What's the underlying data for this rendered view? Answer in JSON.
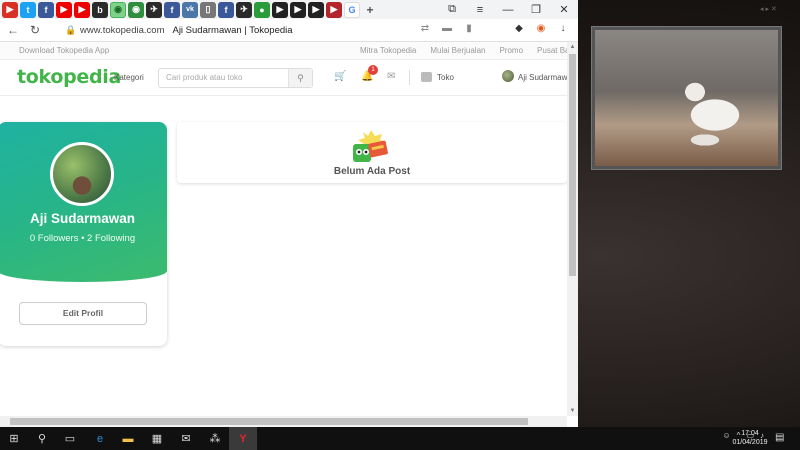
{
  "browser": {
    "tab_colors": [
      "#d93025",
      "#1da1f2",
      "#3b5998",
      "#e00",
      "#e00",
      "#2a2a2a",
      "#7fd18a",
      "#2f8f3e",
      "#2a2a2a",
      "#3b5998",
      "#4a76a8",
      "#777",
      "#3b5998",
      "#2a2a2a",
      "#2a9d3a",
      "#222",
      "#222",
      "#222",
      "#b3242b",
      "#4285f4"
    ],
    "tab_glyphs": [
      "▶",
      "t",
      "f",
      "▶",
      "▶",
      "b",
      "◉",
      "◉",
      "✈",
      "f",
      "vk",
      "▯",
      "f",
      "✈",
      "●",
      "▶",
      "▶",
      "▶",
      "▶",
      "G"
    ],
    "new_tab_label": "+",
    "url": "www.tokopedia.com",
    "page_title": "Aji Sudarmawan | Tokopedia",
    "window_controls": [
      "—",
      "❐",
      "✕"
    ]
  },
  "topline": {
    "download_app": "Download Tokopedia App",
    "links": [
      "Mitra Tokopedia",
      "Mulai Berjualan",
      "Promo",
      "Pusat Bantu"
    ]
  },
  "header": {
    "logo": "tokopedia",
    "kategori": "Kategori",
    "search_placeholder": "Cari produk atau toko",
    "notification_count": "1",
    "toko": "Toko",
    "user_name": "Aji Sudarmawan"
  },
  "profile": {
    "name": "Aji Sudarmawan",
    "stats": "0 Followers • 2 Following",
    "edit_button": "Edit Profil"
  },
  "feed": {
    "empty_text": "Belum Ada Post"
  },
  "taskbar": {
    "time": "17:04",
    "date": "01/04/2019"
  },
  "colors": {
    "brand_green": "#42b549",
    "badge_red": "#e0413b"
  }
}
